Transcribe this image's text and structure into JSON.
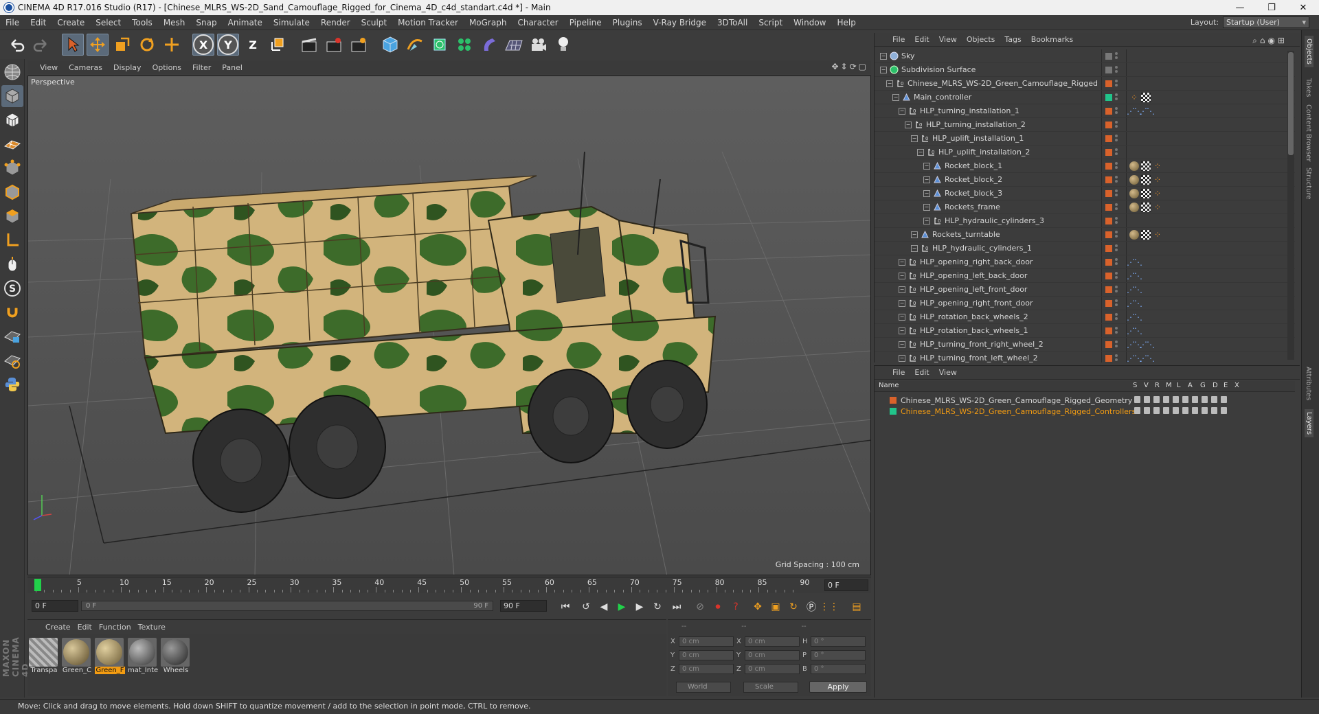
{
  "window": {
    "title": "CINEMA 4D R17.016 Studio (R17) - [Chinese_MLRS_WS-2D_Sand_Camouflage_Rigged_for_Cinema_4D_c4d_standart.c4d *] - Main",
    "minimize": "—",
    "maximize": "❐",
    "close": "✕"
  },
  "menubar": {
    "items": [
      "File",
      "Edit",
      "Create",
      "Select",
      "Tools",
      "Mesh",
      "Snap",
      "Animate",
      "Simulate",
      "Render",
      "Sculpt",
      "Motion Tracker",
      "MoGraph",
      "Character",
      "Pipeline",
      "Plugins",
      "V-Ray Bridge",
      "3DToAll",
      "Script",
      "Window",
      "Help"
    ],
    "layout_label": "Layout:",
    "layout_value": "Startup (User)"
  },
  "toolbar": {
    "axis_x": "X",
    "axis_y": "Y",
    "axis_z": "Z"
  },
  "viewport": {
    "menu": [
      "View",
      "Cameras",
      "Display",
      "Options",
      "Filter",
      "Panel"
    ],
    "label": "Perspective",
    "grid_spacing": "Grid Spacing : 100 cm",
    "nav_icons": "✥⇕⟳▢"
  },
  "timeline": {
    "ticks": [
      "0",
      "5",
      "10",
      "15",
      "20",
      "25",
      "30",
      "35",
      "40",
      "45",
      "50",
      "55",
      "60",
      "65",
      "70",
      "75",
      "80",
      "85",
      "90"
    ],
    "current_frame": "0 F"
  },
  "transport": {
    "start_field": "0 F",
    "range_start": "0 F",
    "range_end": "90 F",
    "end_field": "90 F"
  },
  "material_manager": {
    "menu": [
      "Create",
      "Edit",
      "Function",
      "Texture"
    ],
    "materials": [
      {
        "name": "Transpa",
        "selected": false
      },
      {
        "name": "Green_C",
        "selected": false
      },
      {
        "name": "Green_F",
        "selected": true
      },
      {
        "name": "mat_Inte",
        "selected": false
      },
      {
        "name": "Wheels",
        "selected": false
      }
    ]
  },
  "coordinates": {
    "headers": [
      "--",
      "--",
      "--"
    ],
    "rows": [
      {
        "a": "X",
        "av": "0 cm",
        "b": "X",
        "bv": "0 cm",
        "c": "H",
        "cv": "0 °"
      },
      {
        "a": "Y",
        "av": "0 cm",
        "b": "Y",
        "bv": "0 cm",
        "c": "P",
        "cv": "0 °"
      },
      {
        "a": "Z",
        "av": "0 cm",
        "b": "Z",
        "bv": "0 cm",
        "c": "B",
        "cv": "0 °"
      }
    ],
    "space": "World",
    "mode": "Scale",
    "apply": "Apply"
  },
  "status": "Move: Click and drag to move elements. Hold down SHIFT to quantize movement / add to the selection in point mode, CTRL to remove.",
  "object_manager": {
    "menu": [
      "File",
      "Edit",
      "View",
      "Objects",
      "Tags",
      "Bookmarks"
    ],
    "objects": [
      {
        "name": "Sky",
        "depth": 0,
        "icon": "sky-icon",
        "color": "",
        "tags": []
      },
      {
        "name": "Subdivision Surface",
        "depth": 0,
        "icon": "subdivision-icon",
        "color": "",
        "tags": []
      },
      {
        "name": "Chinese_MLRS_WS-2D_Green_Camouflage_Rigged",
        "depth": 1,
        "icon": "null-icon",
        "color": "#d9622b",
        "tags": []
      },
      {
        "name": "Main_controller",
        "depth": 2,
        "icon": "joint-icon",
        "color": "#21c48a",
        "tags": [
          "ik",
          "check"
        ]
      },
      {
        "name": "HLP_turning_installation_1",
        "depth": 3,
        "icon": "null-icon",
        "color": "#d9622b",
        "tags": [
          "ctrl",
          "ctrl"
        ]
      },
      {
        "name": "HLP_turning_installation_2",
        "depth": 4,
        "icon": "null-icon",
        "color": "#d9622b",
        "tags": []
      },
      {
        "name": "HLP_uplift_installation_1",
        "depth": 5,
        "icon": "null-icon",
        "color": "#d9622b",
        "tags": []
      },
      {
        "name": "HLP_uplift_installation_2",
        "depth": 6,
        "icon": "null-icon",
        "color": "#d9622b",
        "tags": []
      },
      {
        "name": "Rocket_block_1",
        "depth": 7,
        "icon": "mesh-icon",
        "color": "#d9622b",
        "tags": [
          "mat",
          "check",
          "ik"
        ]
      },
      {
        "name": "Rocket_block_2",
        "depth": 7,
        "icon": "mesh-icon",
        "color": "#d9622b",
        "tags": [
          "mat",
          "check",
          "ik"
        ]
      },
      {
        "name": "Rocket_block_3",
        "depth": 7,
        "icon": "mesh-icon",
        "color": "#d9622b",
        "tags": [
          "mat",
          "check",
          "ik"
        ]
      },
      {
        "name": "Rockets_frame",
        "depth": 7,
        "icon": "mesh-icon",
        "color": "#d9622b",
        "tags": [
          "mat",
          "check",
          "ik"
        ]
      },
      {
        "name": "HLP_hydraulic_cylinders_3",
        "depth": 7,
        "icon": "null-icon",
        "color": "#d9622b",
        "tags": []
      },
      {
        "name": "Rockets_turntable",
        "depth": 5,
        "icon": "mesh-icon",
        "color": "#d9622b",
        "tags": [
          "mat",
          "check",
          "ik"
        ]
      },
      {
        "name": "HLP_hydraulic_cylinders_1",
        "depth": 5,
        "icon": "null-icon",
        "color": "#d9622b",
        "tags": []
      },
      {
        "name": "HLP_opening_right_back_door",
        "depth": 3,
        "icon": "null-icon",
        "color": "#d9622b",
        "tags": [
          "ctrl"
        ]
      },
      {
        "name": "HLP_opening_left_back_door",
        "depth": 3,
        "icon": "null-icon",
        "color": "#d9622b",
        "tags": [
          "ctrl"
        ]
      },
      {
        "name": "HLP_opening_left_front_door",
        "depth": 3,
        "icon": "null-icon",
        "color": "#d9622b",
        "tags": [
          "ctrl"
        ]
      },
      {
        "name": "HLP_opening_right_front_door",
        "depth": 3,
        "icon": "null-icon",
        "color": "#d9622b",
        "tags": [
          "ctrl"
        ]
      },
      {
        "name": "HLP_rotation_back_wheels_2",
        "depth": 3,
        "icon": "null-icon",
        "color": "#d9622b",
        "tags": [
          "ctrl"
        ]
      },
      {
        "name": "HLP_rotation_back_wheels_1",
        "depth": 3,
        "icon": "null-icon",
        "color": "#d9622b",
        "tags": [
          "ctrl"
        ]
      },
      {
        "name": "HLP_turning_front_right_wheel_2",
        "depth": 3,
        "icon": "null-icon",
        "color": "#d9622b",
        "tags": [
          "ctrl",
          "ctrl"
        ]
      },
      {
        "name": "HLP_turning_front_left_wheel_2",
        "depth": 3,
        "icon": "null-icon",
        "color": "#d9622b",
        "tags": [
          "ctrl",
          "ctrl"
        ]
      }
    ]
  },
  "layer_manager": {
    "menu": [
      "File",
      "Edit",
      "View"
    ],
    "columns": [
      "Name",
      "S",
      "V",
      "R",
      "M",
      "L",
      "A",
      "G",
      "D",
      "E",
      "X"
    ],
    "layers": [
      {
        "name": "Chinese_MLRS_WS-2D_Green_Camouflage_Rigged_Geometry",
        "color": "#d9622b",
        "text_color": "#d6d6d6"
      },
      {
        "name": "Chinese_MLRS_WS-2D_Green_Camouflage_Rigged_Controllers",
        "color": "#21c48a",
        "text_color": "#f39c12"
      }
    ]
  },
  "side_tabs": [
    "Objects",
    "Takes",
    "Content Browser",
    "Structure",
    "Attributes",
    "Layers"
  ],
  "brand": "MAXON CINEMA 4D",
  "colors": {
    "accent": "#f39c12",
    "play_green": "#21d14a",
    "record_red": "#d9342b",
    "layer_orange": "#d9622b",
    "layer_green": "#21c48a"
  }
}
